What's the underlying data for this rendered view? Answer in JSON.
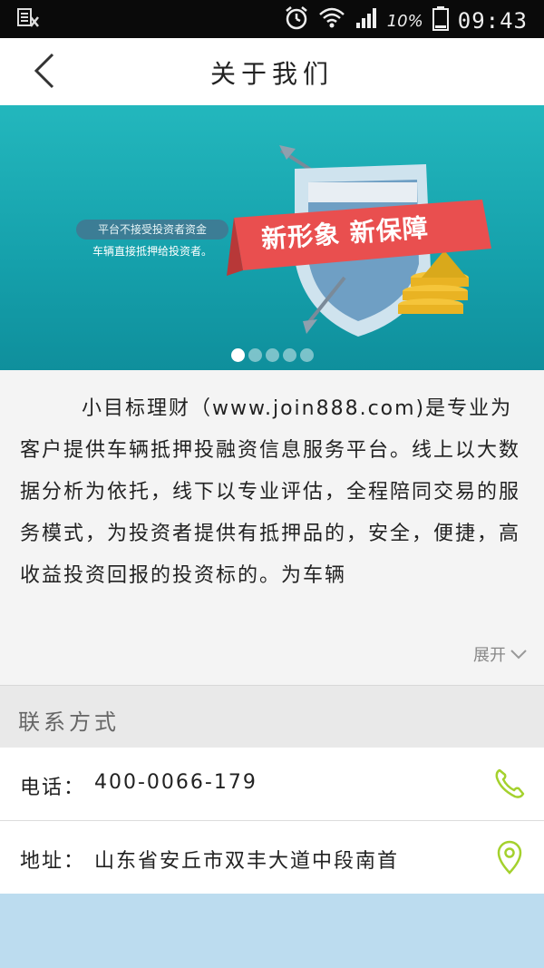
{
  "status_bar": {
    "left_icon": "sim-icon",
    "left_glyph": "後",
    "battery": "10%",
    "time": "09:43"
  },
  "nav": {
    "title": "关于我们"
  },
  "banner": {
    "pill_text": "平台不接受投资者资金",
    "sub_text": "车辆直接抵押给投资者。",
    "ribbon_text": "新形象 新保障",
    "dots": 5,
    "active_dot": 0
  },
  "about": {
    "text": "小目标理财（www.join888.com)是专业为客户提供车辆抵押投融资信息服务平台。线上以大数据分析为依托，线下以专业评估，全程陪同交易的服务模式，为投资者提供有抵押品的，安全，便捷，高收益投资回报的投资标的。为车辆",
    "expand_label": "展开"
  },
  "contact": {
    "header": "联系方式",
    "phone_label": "电话：",
    "phone": "400-0066-179",
    "address_label": "地址：",
    "address": "山东省安丘市双丰大道中段南首"
  },
  "colors": {
    "banner_teal": "#1aaab2",
    "ribbon_red": "#e94f4f",
    "icon_green": "#a4d12d"
  }
}
